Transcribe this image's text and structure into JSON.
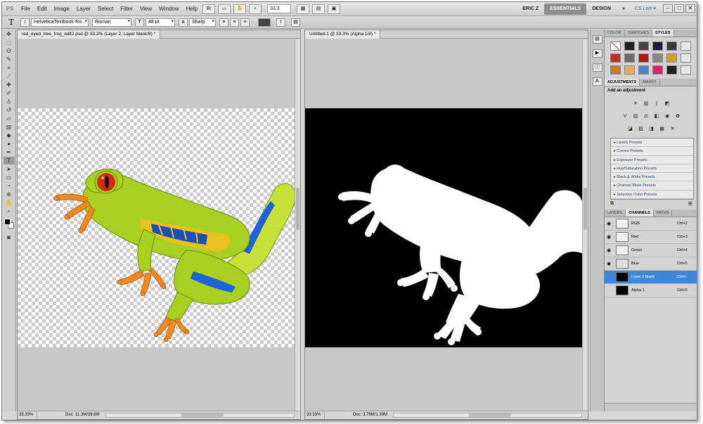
{
  "app": {
    "logo": "PS"
  },
  "menu": [
    "File",
    "Edit",
    "Image",
    "Layer",
    "Select",
    "Filter",
    "View",
    "Window",
    "Help"
  ],
  "menubar_controls": {
    "zoom": "33.3"
  },
  "workspace": {
    "user": "ERIC Z",
    "essentials": "ESSENTIALS",
    "design": "DESIGN",
    "more": "»",
    "cslive": "CS Live ▾"
  },
  "options_bar": {
    "tool_glyph": "T",
    "font_family": "HelveticaTextbook-Ro...",
    "font_style": "Roman",
    "font_size": "48 pt",
    "antialias": "Sharp"
  },
  "docs": {
    "left": {
      "title": "red_eyed_tree_frog_edit2.psd @ 33.3% (Layer 2, Layer Mask/8) *",
      "zoom": "33.33%",
      "info": "Doc: 11.3M/39.6M"
    },
    "right": {
      "title": "Untitled-1 @ 33.3% (Alpha 1/8) *",
      "zoom": "33.33%",
      "info": "Doc: 3.76M/1.39M"
    }
  },
  "panels": {
    "top_tabs": [
      "COLOR",
      "SWATCHES",
      "STYLES"
    ],
    "mid_tabs": [
      "ADJUSTMENTS",
      "MASKS"
    ],
    "add_adjustment": "Add an adjustment",
    "presets": [
      "Levels Presets",
      "Curves Presets",
      "Exposure Presets",
      "Hue/Saturation Presets",
      "Black & White Presets",
      "Channel Mixer Presets",
      "Selective Color Presets"
    ],
    "bottom_tabs": [
      "LAYERS",
      "CHANNELS",
      "PATHS"
    ],
    "channels": [
      {
        "name": "RGB",
        "key": "Ctrl+2"
      },
      {
        "name": "Red",
        "key": "Ctrl+3"
      },
      {
        "name": "Green",
        "key": "Ctrl+4"
      },
      {
        "name": "Blue",
        "key": "Ctrl+5"
      },
      {
        "name": "Layer 2 Mask",
        "key": "Ctrl+\\"
      },
      {
        "name": "Alpha 1",
        "key": "Ctrl+6"
      }
    ]
  },
  "colors": {
    "accent": "#3d86d8",
    "frog_green": "#a8d020",
    "frog_blue": "#1e63d8",
    "eye_red": "#d42a10"
  }
}
